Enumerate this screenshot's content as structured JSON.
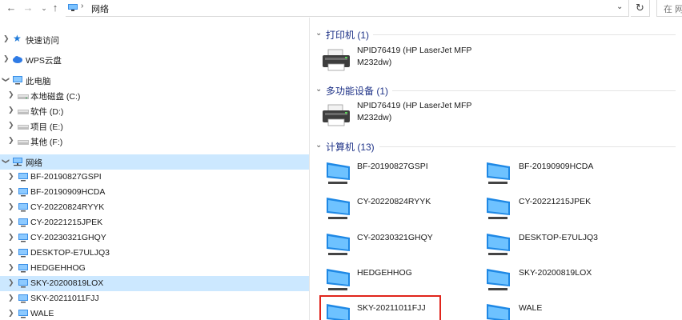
{
  "address": {
    "location": "网络",
    "search_placeholder": "在 网"
  },
  "icons": {
    "back": "back-arrow-icon",
    "forward": "forward-arrow-icon",
    "recent": "recent-dropdown-icon",
    "up": "up-arrow-icon",
    "refresh": "refresh-icon"
  },
  "tree": {
    "quick_access": "快速访问",
    "wps_cloud": "WPS云盘",
    "this_pc": "此电脑",
    "drives": [
      "本地磁盘 (C:)",
      "软件 (D:)",
      "项目 (E:)",
      "其他 (F:)"
    ],
    "network": "网络",
    "computers": [
      "BF-20190827GSPI",
      "BF-20190909HCDA",
      "CY-20220824RYYK",
      "CY-20221215JPEK",
      "CY-20230321GHQY",
      "DESKTOP-E7ULJQ3",
      "HEDGEHHOG",
      "SKY-20200819LOX",
      "SKY-20211011FJJ",
      "WALE"
    ]
  },
  "groups": {
    "printers": {
      "title": "打印机 (1)",
      "item_line1": "NPID76419 (HP LaserJet MFP",
      "item_line2": "M232dw)"
    },
    "multifunction": {
      "title": "多功能设备 (1)",
      "item_line1": "NPID76419 (HP LaserJet MFP",
      "item_line2": "M232dw)"
    },
    "computers": {
      "title": "计算机 (13)",
      "items": [
        "BF-20190827GSPI",
        "BF-20190909HCDA",
        "CY-20220824RYYK",
        "CY-20221215JPEK",
        "CY-20230321GHQY",
        "DESKTOP-E7ULJQ3",
        "HEDGEHHOG",
        "SKY-20200819LOX",
        "SKY-20211011FJJ",
        "WALE"
      ]
    }
  },
  "colors": {
    "selection": "#cce8ff",
    "group_title": "#1e3287",
    "highlight_border": "#e0251c"
  }
}
